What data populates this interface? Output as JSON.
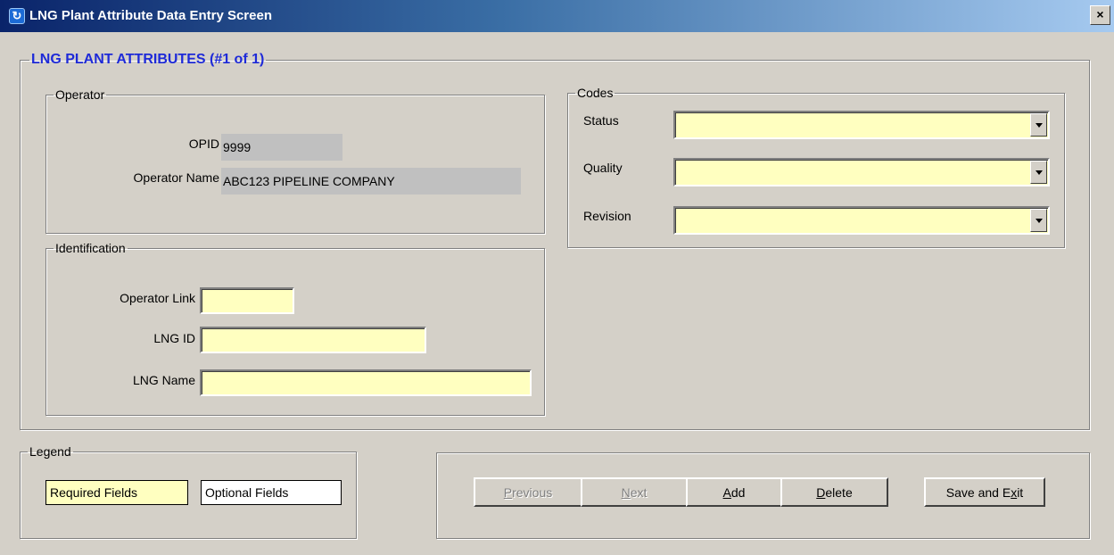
{
  "window": {
    "title": "LNG Plant Attribute Data Entry Screen",
    "close_label": "×"
  },
  "main_group": {
    "title": "LNG PLANT ATTRIBUTES (#1 of 1)"
  },
  "operator": {
    "title": "Operator",
    "opid_label": "OPID",
    "opid_value": "9999",
    "name_label": "Operator Name",
    "name_value": "ABC123 PIPELINE COMPANY"
  },
  "identification": {
    "title": "Identification",
    "operator_link_label": "Operator Link",
    "operator_link_value": "",
    "lng_id_label": "LNG ID",
    "lng_id_value": "",
    "lng_name_label": "LNG Name",
    "lng_name_value": ""
  },
  "codes": {
    "title": "Codes",
    "status_label": "Status",
    "status_value": "",
    "quality_label": "Quality",
    "quality_value": "",
    "revision_label": "Revision",
    "revision_value": ""
  },
  "legend": {
    "title": "Legend",
    "required_label": "Required Fields",
    "optional_label": "Optional Fields"
  },
  "buttons": {
    "previous": {
      "prefix": "",
      "accel": "P",
      "rest": "revious"
    },
    "next": {
      "prefix": "",
      "accel": "N",
      "rest": "ext"
    },
    "add": {
      "prefix": "",
      "accel": "A",
      "rest": "dd"
    },
    "delete": {
      "prefix": "",
      "accel": "D",
      "rest": "elete"
    },
    "save_exit": {
      "prefix": "Save and E",
      "accel": "x",
      "rest": "it"
    }
  },
  "colors": {
    "required": "#ffffc0",
    "optional": "#ffffff",
    "readonly": "#c0c0c0",
    "group_title": "#1e2ad8"
  }
}
